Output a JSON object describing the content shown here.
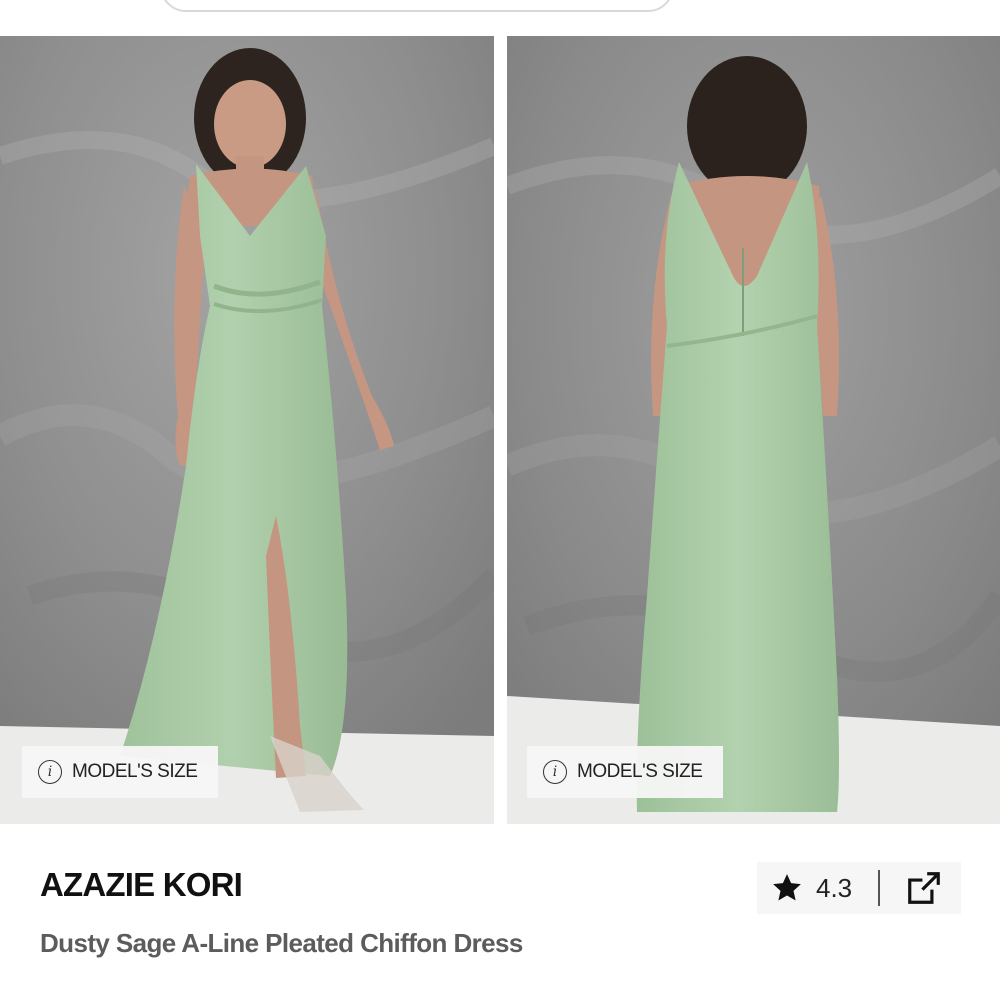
{
  "product": {
    "brand": "AZAZIE KORI",
    "name": "Dusty Sage A-Line Pleated Chiffon Dress",
    "rating": "4.3"
  },
  "gallery": {
    "badge_label": "MODEL'S SIZE",
    "badge_icon": "info-icon",
    "images": [
      {
        "view": "front",
        "badge_label": "MODEL'S SIZE"
      },
      {
        "view": "back",
        "badge_label": "MODEL'S SIZE"
      }
    ]
  },
  "icons": {
    "rating": "star-icon",
    "share": "external-link-icon"
  },
  "colors": {
    "dress": "#a8c8a4",
    "backdrop": "#8d8d8d",
    "floor": "#ebebea",
    "text_primary": "#111111",
    "text_secondary": "#5c5c5c"
  }
}
